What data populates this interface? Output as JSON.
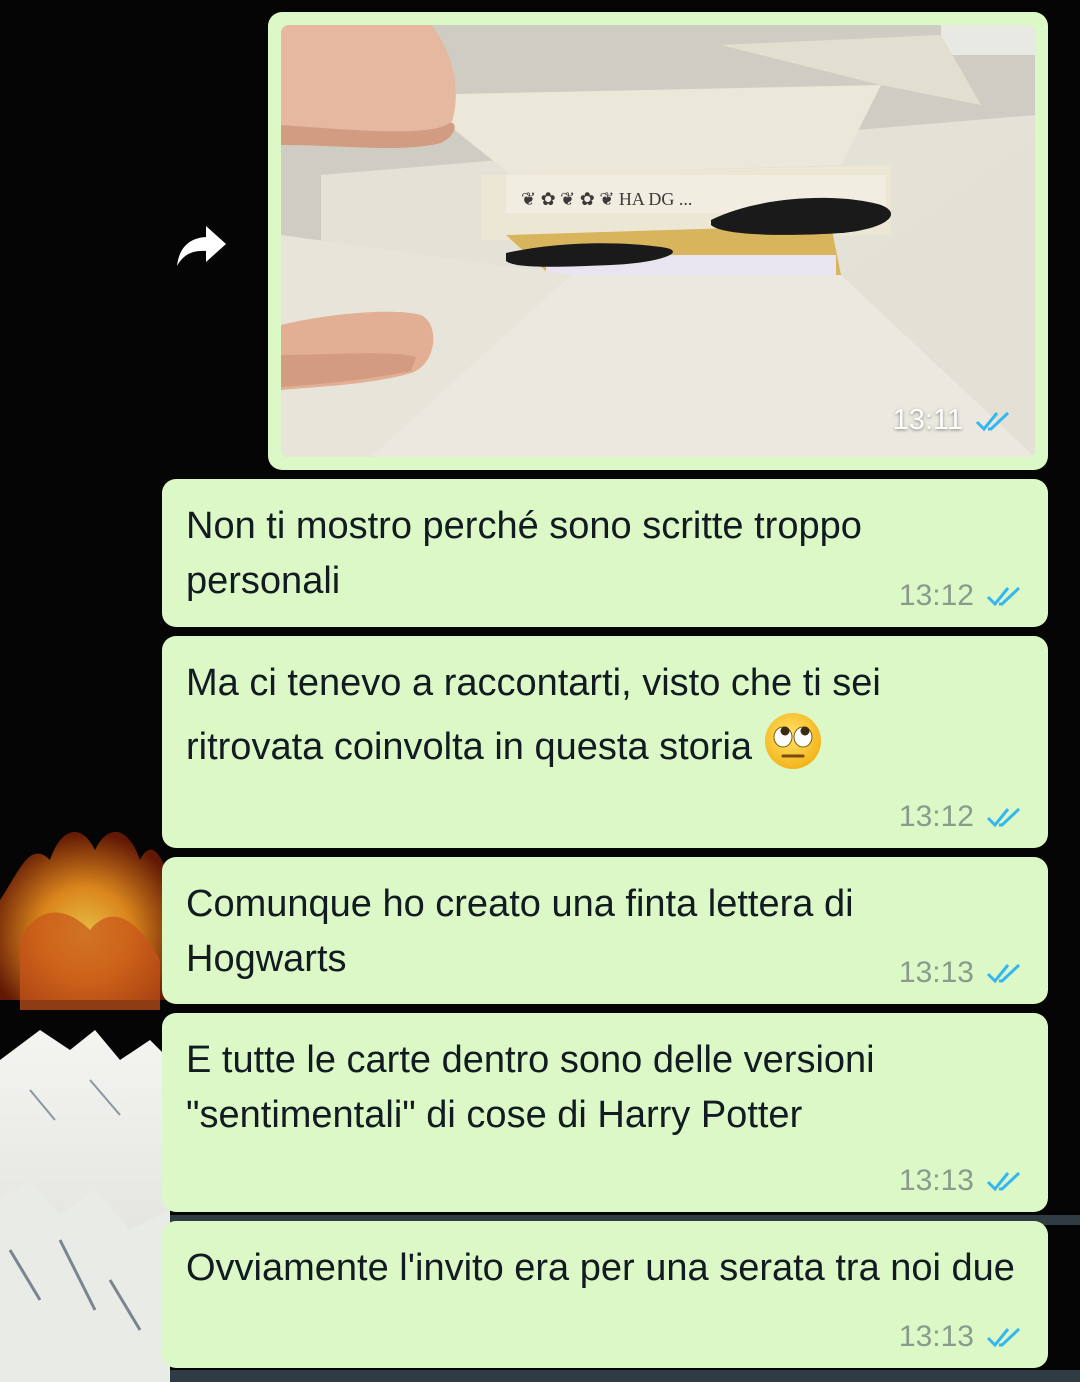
{
  "colors": {
    "outgoing_bubble": "#dcf8c6",
    "read_tick": "#34b7f1",
    "timestamp": "#8a9a8c",
    "top_strip": "#0b4f46"
  },
  "icons": {
    "forward": "forward-arrow-icon",
    "read_receipt": "double-check-icon",
    "emoji": "face-with-rolling-eyes"
  },
  "image_message": {
    "time": "13:11",
    "status": "read"
  },
  "messages": [
    {
      "text": "Non ti mostro perché sono scritte troppo personali",
      "time": "13:12",
      "status": "read"
    },
    {
      "text": "Ma ci tenevo a raccontarti, visto che ti sei ritrovata coinvolta in questa storia",
      "emoji": "🙄",
      "time": "13:12",
      "status": "read"
    },
    {
      "text": "Comunque ho creato una finta lettera di Hogwarts",
      "time": "13:13",
      "status": "read"
    },
    {
      "text": "E tutte le carte dentro sono delle versioni \"sentimentali\" di cose di Harry Potter",
      "time": "13:13",
      "status": "read"
    },
    {
      "text": "Ovviamente l'invito era per una serata tra noi due",
      "time": "13:13",
      "status": "read"
    }
  ]
}
